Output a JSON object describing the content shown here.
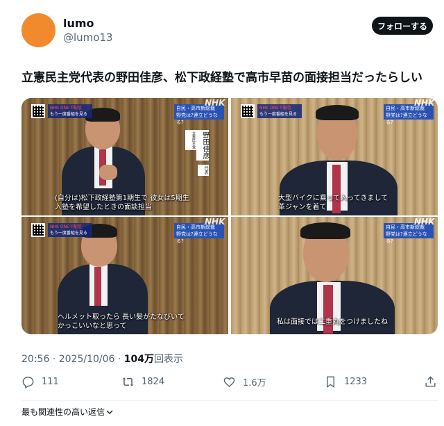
{
  "user": {
    "name": "lumo",
    "handle": "@lumo13",
    "avatar_color": "#f08a2c"
  },
  "follow_label": "フォローする",
  "tweet_text": "立憲民主党代表の野田佳彦、松下政経塾で高市早苗の面接担当だったらしい",
  "media": {
    "nhk_tag_line1": "NHK ONEで配信",
    "nhk_tag_line2": "もう一度番組を見る",
    "topic_line1": "自民・高市新総裁",
    "topic_line2": "野党は?連立どうなる?",
    "logo": "NHK",
    "nameplate_name": "野田佳彦",
    "nameplate_party": "立憲民主党",
    "nameplate_role": "代表",
    "captions": [
      [
        "(自分は)松下政経塾第1期生で 彼女は5期生",
        "入塾を希望したときの面談担当"
      ],
      [
        "大型バイクに乗って入ってきまして",
        "革ジャンを着て"
      ],
      [
        "ヘルメット取ったら 長い髪がたなびいて",
        "かっこいいなと思って"
      ],
      [
        "私は面接では二重丸をつけましたね"
      ]
    ]
  },
  "meta": {
    "time": "20:56",
    "date": "2025/10/06",
    "views_number": "104万",
    "views_label": "回表示",
    "separator": " · "
  },
  "actions": {
    "replies": "111",
    "reposts": "1824",
    "likes": "1.6万",
    "bookmarks": "1233"
  },
  "replies_sort_label": "最も関連性の高い返信",
  "colors": {
    "text": "#0f1419",
    "secondary": "#536471",
    "topic_blue": "#2952b3"
  }
}
